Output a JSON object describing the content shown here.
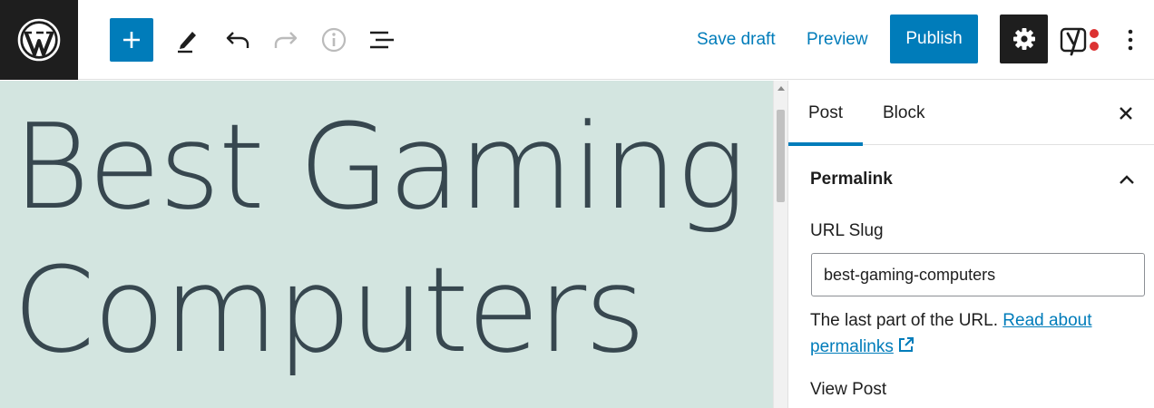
{
  "toolbar": {
    "save_draft_label": "Save draft",
    "preview_label": "Preview",
    "publish_label": "Publish"
  },
  "editor": {
    "title_line1": "Best Gaming",
    "title_line2": "Computers"
  },
  "sidebar": {
    "tabs": [
      {
        "label": "Post",
        "active": true
      },
      {
        "label": "Block",
        "active": false
      }
    ],
    "panel_title": "Permalink",
    "slug_label": "URL Slug",
    "slug_value": "best-gaming-computers",
    "help_text": "The last part of the URL.",
    "help_link_line1": "Read about",
    "help_link_line2": "permalinks",
    "view_post_label": "View Post"
  },
  "icons": {
    "logo": "wordpress-logo",
    "add": "plus-icon",
    "tools": "pencil-icon",
    "undo": "undo-icon",
    "redo": "redo-icon",
    "details": "info-icon",
    "outline": "list-view-icon",
    "settings": "gear-icon",
    "seo": "yoast-icon",
    "more": "more-vertical-icon",
    "close": "close-icon",
    "collapse": "chevron-up-icon",
    "external": "external-link-icon"
  },
  "colors": {
    "accent": "#007cba",
    "dark": "#1e1e1e",
    "canvas_bg": "#d3e5e0",
    "title_text": "#37474f",
    "yoast_dot": "#dc3232",
    "disabled": "#bbbbbb"
  }
}
